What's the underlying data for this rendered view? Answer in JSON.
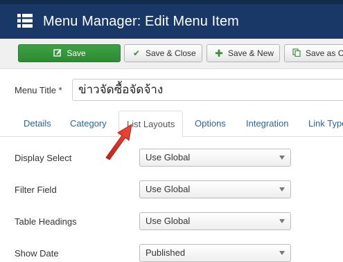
{
  "header": {
    "title": "Menu Manager: Edit Menu Item",
    "icon": "menu-list-icon"
  },
  "toolbar": {
    "save": {
      "label": "Save",
      "icon": "edit-icon"
    },
    "save_close": {
      "label": "Save & Close",
      "icon": "check-icon"
    },
    "save_new": {
      "label": "Save & New",
      "icon": "plus-icon"
    },
    "save_as": {
      "label": "Save as C",
      "icon": "copy-icon"
    }
  },
  "form": {
    "menu_title_label": "Menu Title *",
    "menu_title_value": "ข่าวจัดซื้อจัดจ้าง"
  },
  "tabs": [
    {
      "label": "Details"
    },
    {
      "label": "Category"
    },
    {
      "label": "List Layouts",
      "active": true
    },
    {
      "label": "Options"
    },
    {
      "label": "Integration"
    },
    {
      "label": "Link Type"
    }
  ],
  "fields": [
    {
      "label": "Display Select",
      "value": "Use Global"
    },
    {
      "label": "Filter Field",
      "value": "Use Global"
    },
    {
      "label": "Table Headings",
      "value": "Use Global"
    },
    {
      "label": "Show Date",
      "value": "Published"
    }
  ],
  "colors": {
    "header_bg": "#1a3867",
    "save_green": "#2d8a32",
    "tab_link": "#2a6496",
    "annotation_arrow": "#e03a2c"
  }
}
